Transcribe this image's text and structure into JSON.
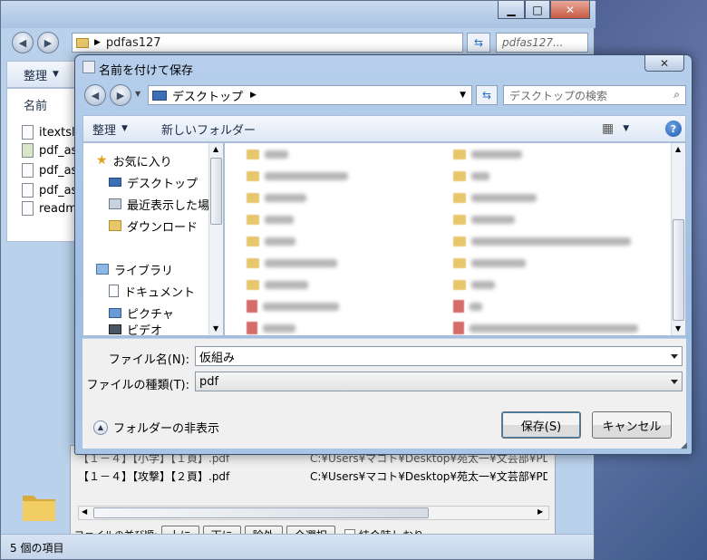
{
  "explorer": {
    "address": "pdfas127",
    "search_placeholder": "pdfas127...",
    "toolbar_organize": "整理",
    "column_name": "名前",
    "files": [
      "itextsl",
      "pdf_as",
      "pdf_as",
      "pdf_as",
      "readm"
    ],
    "list_rows": [
      {
        "name": "【１－４】【小学】【１頁】.pdf",
        "path": "C:¥Users¥マコト¥Desktop¥苑太一¥文芸部¥PDF"
      },
      {
        "name": "【１－４】【攻撃】【２頁】.pdf",
        "path": "C:¥Users¥マコト¥Desktop¥苑太一¥文芸部¥PDF"
      }
    ],
    "sort_label": "ファイルの並び順:",
    "btn_up": "上に",
    "btn_down": "下に",
    "btn_remove": "除外",
    "btn_select_all": "全選択",
    "bookmark_label": "結合時しおり",
    "status_text": "5 個の項目"
  },
  "dialog": {
    "title": "名前を付けて保存",
    "close_glyph": "✕",
    "address": "デスクトップ",
    "search_placeholder": "デスクトップの検索",
    "organize": "整理",
    "new_folder": "新しいフォルダー",
    "nav": {
      "favorites": "お気に入り",
      "desktop": "デスクトップ",
      "recent": "最近表示した場所",
      "downloads": "ダウンロード",
      "libraries": "ライブラリ",
      "documents": "ドキュメント",
      "pictures": "ピクチャ",
      "videos": "ビデオ"
    },
    "filename_label": "ファイル名(N):",
    "filename_value": "仮組み",
    "filetype_label": "ファイルの種類(T):",
    "filetype_value": "pdf",
    "hide_folders": "フォルダーの非表示",
    "save_button": "保存(S)",
    "cancel_button": "キャンセル"
  },
  "colors": {
    "accent_blue": "#2a6fc1",
    "folder_yellow": "#e7c76b",
    "dialog_frame": "#a9c5e6"
  }
}
